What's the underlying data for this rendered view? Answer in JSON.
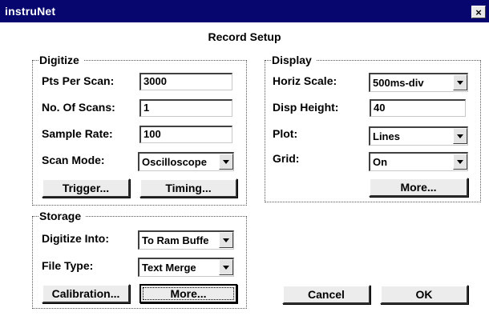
{
  "window": {
    "title": "instruNet",
    "close_glyph": "×"
  },
  "dialog": {
    "heading": "Record Setup"
  },
  "digitize": {
    "title": "Digitize",
    "pts_per_scan": {
      "label": "Pts Per Scan:",
      "value": "3000"
    },
    "num_scans": {
      "label": "No. Of Scans:",
      "value": "1"
    },
    "sample_rate": {
      "label": "Sample Rate:",
      "value": "100"
    },
    "scan_mode": {
      "label": "Scan Mode:",
      "value": "Oscilloscope"
    },
    "trigger_button": "Trigger...",
    "timing_button": "Timing..."
  },
  "display": {
    "title": "Display",
    "horiz_scale": {
      "label": "Horiz Scale:",
      "value": "500ms-div"
    },
    "disp_height": {
      "label": "Disp Height:",
      "value": "40"
    },
    "plot": {
      "label": "Plot:",
      "value": "Lines"
    },
    "grid": {
      "label": "Grid:",
      "value": "On"
    },
    "more_button": "More..."
  },
  "storage": {
    "title": "Storage",
    "digitize_into": {
      "label": "Digitize Into:",
      "value": "To Ram Buffe"
    },
    "file_type": {
      "label": "File Type:",
      "value": "Text Merge"
    },
    "calibration_button": "Calibration...",
    "more_button": "More..."
  },
  "actions": {
    "cancel": "Cancel",
    "ok": "OK"
  },
  "icons": {
    "dropdown": "chevron-down-icon",
    "close": "close-icon"
  },
  "colors": {
    "titlebar": "#06066e",
    "background": "#ffffff",
    "button_face": "#ececec"
  }
}
